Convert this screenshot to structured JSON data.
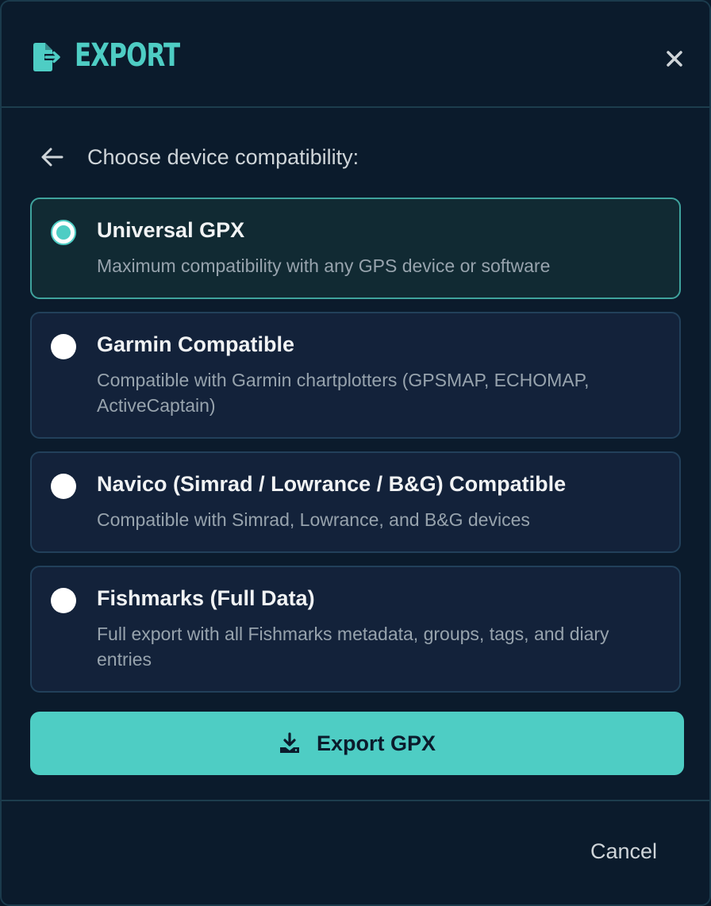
{
  "dialog": {
    "title": "EXPORT",
    "header_icon": "file-export-icon",
    "close_icon": "close-icon"
  },
  "step": {
    "back_icon": "arrow-left-icon",
    "label": "Choose device compatibility:"
  },
  "options": [
    {
      "title": "Universal GPX",
      "description": "Maximum compatibility with any GPS device or software",
      "selected": true
    },
    {
      "title": "Garmin Compatible",
      "description": "Compatible with Garmin chartplotters (GPSMAP, ECHOMAP, ActiveCaptain)",
      "selected": false
    },
    {
      "title": "Navico (Simrad / Lowrance / B&G) Compatible",
      "description": "Compatible with Simrad, Lowrance, and B&G devices",
      "selected": false
    },
    {
      "title": "Fishmarks (Full Data)",
      "description": "Full export with all Fishmarks metadata, groups, tags, and diary entries",
      "selected": false
    }
  ],
  "export_button": {
    "label": "Export GPX",
    "icon": "download-icon"
  },
  "footer": {
    "cancel_label": "Cancel"
  },
  "colors": {
    "accent": "#4ecdc4",
    "background": "#0b1b2c",
    "option_bg": "#13223a",
    "selected_bg": "#112a33"
  }
}
